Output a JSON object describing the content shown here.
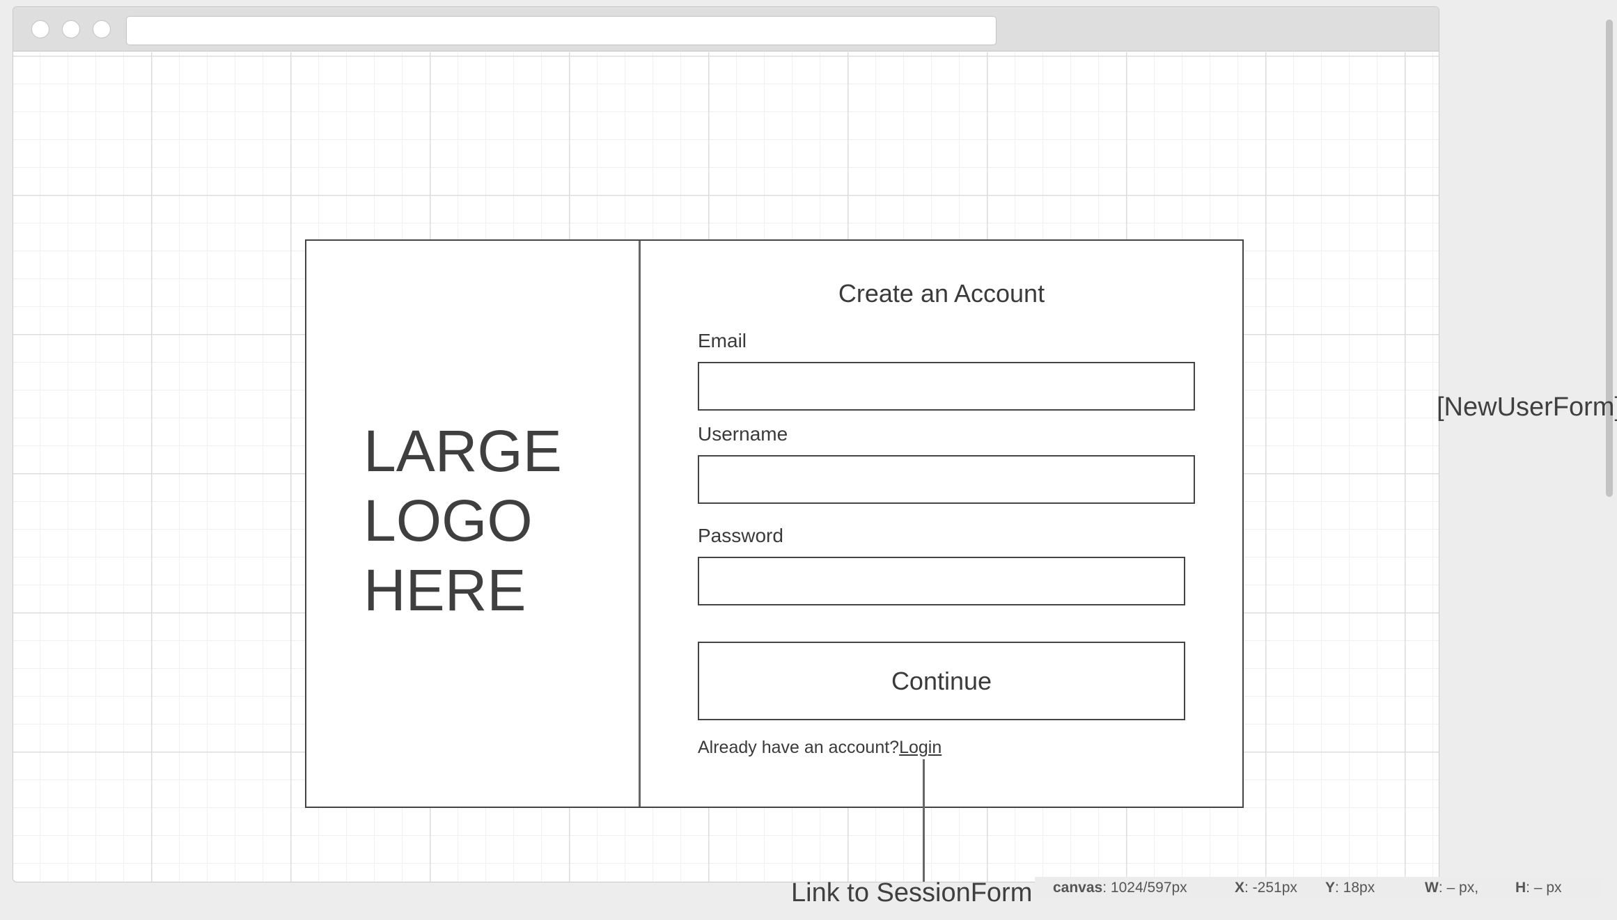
{
  "browser": {
    "address_value": ""
  },
  "logo": {
    "text": "LARGE\nLOGO\nHERE"
  },
  "form": {
    "title": "Create an Account",
    "email_label": "Email",
    "email_value": "",
    "username_label": "Username",
    "username_value": "",
    "password_label": "Password",
    "password_value": "",
    "continue_label": "Continue",
    "login_prompt": "Already have an account?",
    "login_link": "Login"
  },
  "annotations": {
    "component_name": "[NewUserForm]",
    "link_note": "Link to SessionForm"
  },
  "statusbar": {
    "canvas_label": "canvas",
    "canvas_value": ": 1024/597px",
    "x_label": "X",
    "x_value": ": -251px",
    "y_label": "Y",
    "y_value": ": 18px",
    "w_label": "W",
    "w_value": ": – px,",
    "h_label": "H",
    "h_value": ": – px"
  }
}
